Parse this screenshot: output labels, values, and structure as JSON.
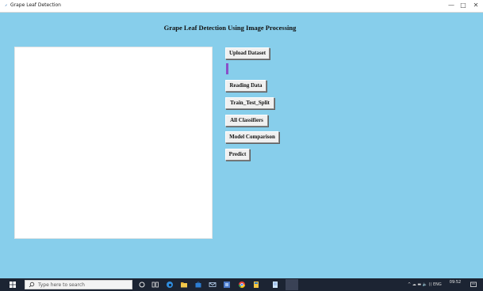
{
  "window": {
    "title": "Grape Leaf Detection",
    "minimize": "—",
    "maximize": "□",
    "close": "✕"
  },
  "main": {
    "heading": "Grape Leaf Detection Using Image Processing"
  },
  "buttons": {
    "upload": "Upload Dataset",
    "reading": "Reading Data",
    "split": "Train_Test_Split",
    "classifiers": "All Classifiers",
    "comparison": "Model Comparison",
    "predict": "Predict"
  },
  "taskbar": {
    "search_placeholder": "Type here to search",
    "tray_text": "^ ☁ ▬ 🔈 (( ENG",
    "time": "09:52"
  },
  "colors": {
    "background": "#87ceeb",
    "progress_accent": "#8a4fc8",
    "taskbar": "#1c2433"
  },
  "icons": [
    "windows-start-icon",
    "search-icon",
    "task-view-icon",
    "edge-icon",
    "file-explorer-icon",
    "store-icon",
    "mail-icon",
    "app-icon",
    "chrome-icon",
    "photos-icon",
    "notepad-icon",
    "notification-icon"
  ]
}
